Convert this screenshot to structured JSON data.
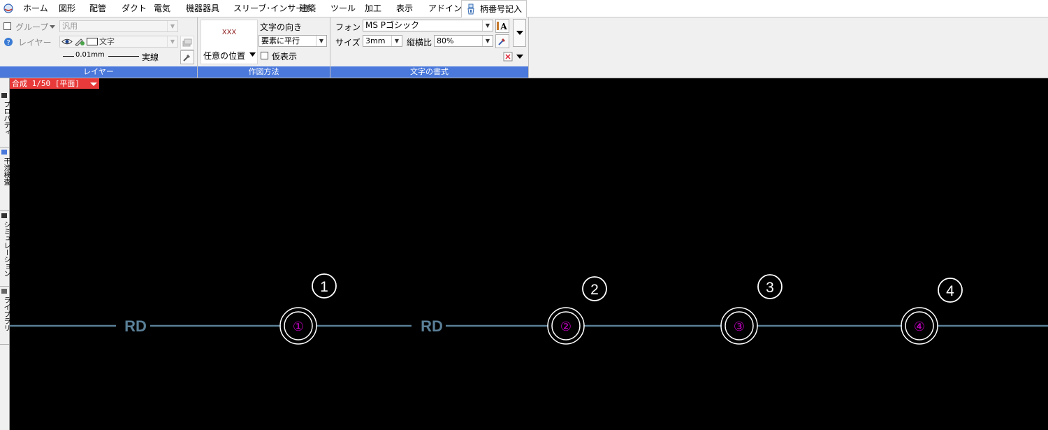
{
  "menu": {
    "items": [
      "ホーム",
      "図形",
      "配管",
      "ダクト",
      "電気",
      "機器器具",
      "スリーブ･インサート",
      "建築",
      "ツール",
      "加工",
      "表示",
      "アドイン"
    ],
    "active_tab": "柄番号記入"
  },
  "layer_group": {
    "group_label": "グループ",
    "group_value": "汎用",
    "layer_label": "レイヤー",
    "layer_value": "文字",
    "line_width": "0.01mm",
    "line_type": "実線",
    "footer": "レイヤー"
  },
  "draw_group": {
    "preview_text": "XXX",
    "position_label": "任意の位置",
    "direction_label": "文字の向き",
    "direction_value": "要素に平行",
    "temp_display_label": "仮表示",
    "footer": "作図方法"
  },
  "text_group": {
    "font_label": "フォント",
    "font_value": "MS Pゴシック",
    "size_label": "サイズ",
    "size_value": "3mm",
    "ratio_label": "縦横比",
    "ratio_value": "80%",
    "footer": "文字の書式"
  },
  "dock": {
    "tabs": [
      "プロパティ",
      "干渉検査",
      "シミュレーション",
      "ライブラリ"
    ]
  },
  "canvas": {
    "view_label": "合成 1/50 [平面]",
    "line_label_1": "RD",
    "line_label_2": "RD",
    "markers": [
      "①",
      "②",
      "③",
      "④"
    ],
    "numbers": [
      "1",
      "2",
      "3",
      "4"
    ]
  },
  "colors": {
    "ribbon_footer": "#4a78db",
    "canvas_bg": "#000000",
    "pipe_line": "#5a7f97",
    "marker_text": "#c800c8",
    "view_label_bg": "#e83a3a"
  }
}
